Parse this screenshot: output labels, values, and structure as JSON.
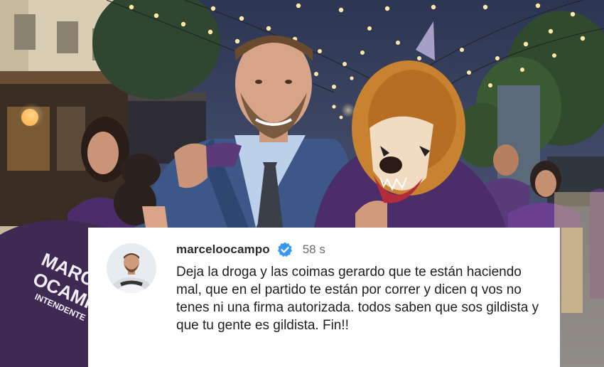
{
  "photo": {
    "shirt_text_line1": "MARCELO",
    "shirt_text_line2": "OCAMPO",
    "shirt_text_line3": "INTENDENTE",
    "colors": {
      "sky": "#3f4a6a",
      "string_lights": "#ffe9a8",
      "suit": "#3c5788",
      "purple_shirt": "#4b2d6a",
      "lion_mane": "#c9822f"
    }
  },
  "comment": {
    "username": "marceloocampo",
    "verified": true,
    "time": "58 s",
    "text": "Deja la droga y las coimas gerardo que te están haciendo mal, que en el partido te están por correr y dicen q vos no tenes ni una firma autorizada. todos saben que sos gildista y que tu gente es gildista. Fin!!",
    "colors": {
      "card": "#ffffff",
      "verified_badge": "#3897f0"
    }
  }
}
